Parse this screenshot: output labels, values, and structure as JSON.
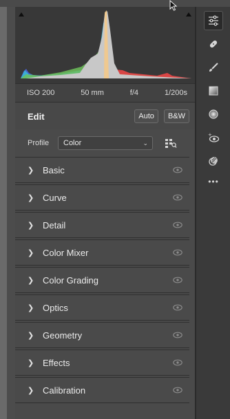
{
  "histogram": {
    "colors": {
      "background": "#383838",
      "luminance": "#c8c8c8",
      "red": "#e04646",
      "cyan": "#3ab6d6",
      "green": "#6dbf5a",
      "blue": "#4a63d8"
    }
  },
  "exif": {
    "iso": "ISO 200",
    "focal_length": "50 mm",
    "aperture": "f/4",
    "shutter": "1/200s"
  },
  "edit": {
    "title": "Edit",
    "auto_label": "Auto",
    "bw_label": "B&W"
  },
  "profile": {
    "label": "Profile",
    "value": "Color"
  },
  "sections": [
    {
      "label": "Basic"
    },
    {
      "label": "Curve"
    },
    {
      "label": "Detail"
    },
    {
      "label": "Color Mixer"
    },
    {
      "label": "Color Grading"
    },
    {
      "label": "Optics"
    },
    {
      "label": "Geometry"
    },
    {
      "label": "Effects"
    },
    {
      "label": "Calibration"
    }
  ],
  "toolbar": {
    "icons": [
      "edit-sliders-icon",
      "healing-bandage-icon",
      "brush-icon",
      "linear-gradient-icon",
      "radial-gradient-icon",
      "red-eye-icon",
      "presets-icon",
      "more-icon"
    ],
    "more_label": "•••"
  }
}
